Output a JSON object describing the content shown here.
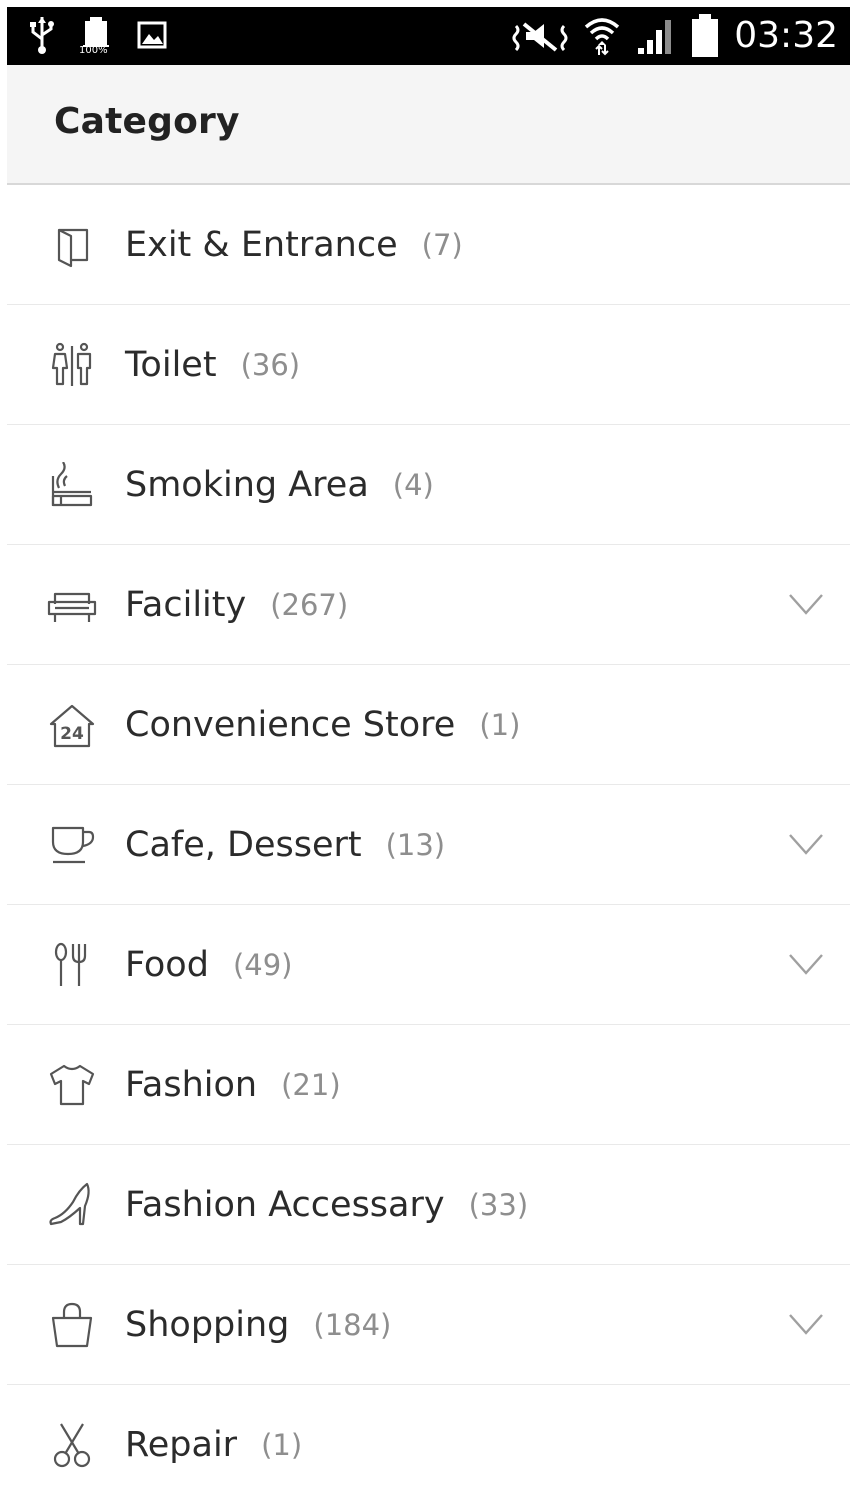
{
  "status_bar": {
    "time": "03:32",
    "battery_label": "100%",
    "icons": [
      "usb-icon",
      "battery-storage-icon",
      "image-icon",
      "mute-vibrate-icon",
      "wifi-icon",
      "signal-icon",
      "battery-icon"
    ]
  },
  "header": {
    "title": "Category"
  },
  "categories": [
    {
      "label": "Exit & Entrance",
      "count": "(7)",
      "icon": "door-icon",
      "expandable": false
    },
    {
      "label": "Toilet",
      "count": "(36)",
      "icon": "toilet-icon",
      "expandable": false
    },
    {
      "label": "Smoking Area",
      "count": "(4)",
      "icon": "smoking-icon",
      "expandable": false
    },
    {
      "label": "Facility",
      "count": "(267)",
      "icon": "sofa-icon",
      "expandable": true
    },
    {
      "label": "Convenience Store",
      "count": "(1)",
      "icon": "store-24-icon",
      "expandable": false
    },
    {
      "label": "Cafe, Dessert",
      "count": "(13)",
      "icon": "cup-icon",
      "expandable": true
    },
    {
      "label": "Food",
      "count": "(49)",
      "icon": "fork-knife-icon",
      "expandable": true
    },
    {
      "label": "Fashion",
      "count": "(21)",
      "icon": "shirt-icon",
      "expandable": false
    },
    {
      "label": "Fashion Accessary",
      "count": "(33)",
      "icon": "high-heel-icon",
      "expandable": false
    },
    {
      "label": "Shopping",
      "count": "(184)",
      "icon": "shopping-bag-icon",
      "expandable": true
    },
    {
      "label": "Repair",
      "count": "(1)",
      "icon": "scissors-icon",
      "expandable": false
    }
  ],
  "colors": {
    "header_bg": "#f5f5f5",
    "label": "#2b2b2b",
    "count": "#8e8e8e",
    "icon_stroke": "#555555",
    "chevron": "#a0a0a0"
  }
}
